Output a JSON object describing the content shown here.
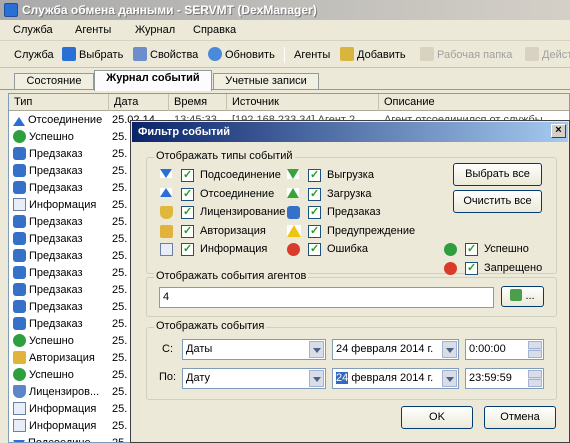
{
  "window": {
    "title": "Служба обмена данными - SERVMT (DexManager)"
  },
  "menu": [
    "Служба",
    "Агенты",
    "Журнал",
    "Справка"
  ],
  "toolbar": {
    "service": "Служба",
    "select": "Выбрать",
    "properties": "Свойства",
    "refresh": "Обновить",
    "agents": "Агенты",
    "add": "Добавить",
    "workfolder": "Рабочая папка",
    "actions": "Дейст"
  },
  "tabs": [
    "Состояние",
    "Журнал событий",
    "Учетные записи"
  ],
  "grid": {
    "columns": [
      "Тип",
      "Дата",
      "Время",
      "Источник",
      "Описание"
    ],
    "first_row": {
      "time": "13:45:33",
      "source": "[192.168.233.34] Агент 2",
      "desc": "Агент отсоединился от службы"
    },
    "rows": [
      {
        "type": "Отсоединение",
        "date": "25.02.14"
      },
      {
        "type": "Успешно",
        "date": "25."
      },
      {
        "type": "Предзаказ",
        "date": "25."
      },
      {
        "type": "Предзаказ",
        "date": "25."
      },
      {
        "type": "Предзаказ",
        "date": "25."
      },
      {
        "type": "Информация",
        "date": "25."
      },
      {
        "type": "Предзаказ",
        "date": "25."
      },
      {
        "type": "Предзаказ",
        "date": "25."
      },
      {
        "type": "Предзаказ",
        "date": "25."
      },
      {
        "type": "Предзаказ",
        "date": "25."
      },
      {
        "type": "Предзаказ",
        "date": "25."
      },
      {
        "type": "Предзаказ",
        "date": "25."
      },
      {
        "type": "Предзаказ",
        "date": "25."
      },
      {
        "type": "Успешно",
        "date": "25."
      },
      {
        "type": "Авторизация",
        "date": "25."
      },
      {
        "type": "Успешно",
        "date": "25."
      },
      {
        "type": "Лицензиров...",
        "date": "25."
      },
      {
        "type": "Информация",
        "date": "25."
      },
      {
        "type": "Информация",
        "date": "25."
      },
      {
        "type": "Подсоедине...",
        "date": "25."
      }
    ]
  },
  "dialog": {
    "title": "Фильтр событий",
    "types_group": "Отображать типы событий",
    "types_left": [
      "Подсоединение",
      "Отсоединение",
      "Лицензирование",
      "Авторизация",
      "Информация"
    ],
    "types_mid": [
      "Выгрузка",
      "Загрузка",
      "Предзаказ",
      "Предупреждение",
      "Ошибка"
    ],
    "types_right": [
      "Успешно",
      "Запрещено"
    ],
    "select_all": "Выбрать все",
    "clear_all": "Очистить все",
    "agents_group": "Отображать события агентов",
    "agents_value": "4",
    "browse_label": "...",
    "events_group": "Отображать события",
    "from_label": "С:",
    "to_label": "По:",
    "from_mode": "Даты",
    "to_mode": "Дату",
    "from_date": "24 февраля 2014 г.",
    "to_date_day": "24",
    "to_date_rest": "февраля 2014 г.",
    "from_time": "0:00:00",
    "to_time": "23:59:59",
    "ok": "OK",
    "cancel": "Отмена"
  },
  "colors": {
    "title_active": "#0a246a",
    "accent": "#2a6fd6"
  }
}
